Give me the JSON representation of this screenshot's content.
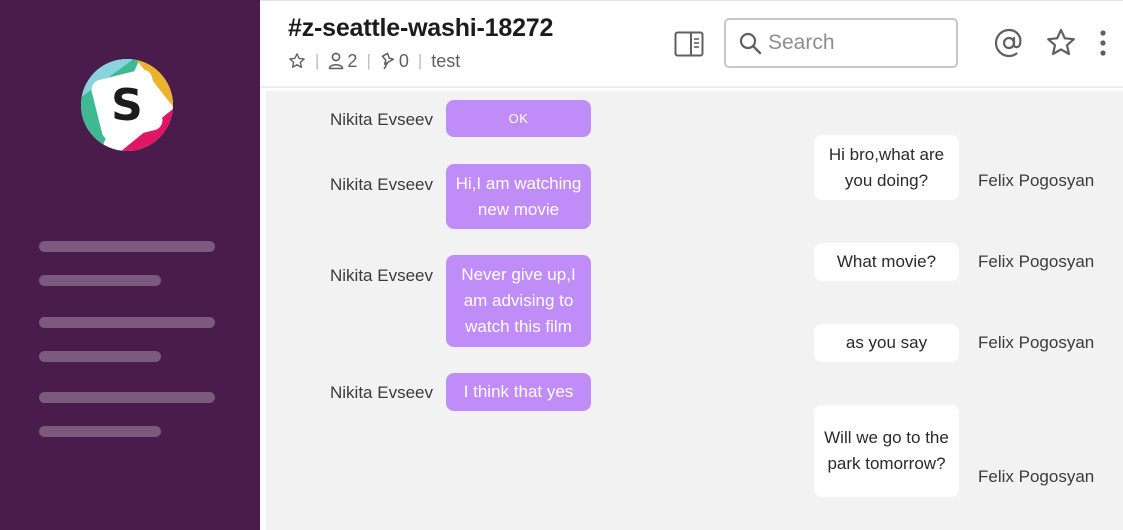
{
  "header": {
    "channel_name": "#z-seattle-washi-18272",
    "members_count": "2",
    "pinned_count": "0",
    "topic": "test"
  },
  "search": {
    "placeholder": "Search"
  },
  "messages": {
    "left": [
      {
        "author": "Nikita Evseev",
        "text": "OK"
      },
      {
        "author": "Nikita Evseev",
        "text": "Hi,I am watching new movie"
      },
      {
        "author": "Nikita Evseev",
        "text": "Never give up,I am advising to watch this film"
      },
      {
        "author": "Nikita Evseev",
        "text": "I think that yes"
      }
    ],
    "right": [
      {
        "author": "Felix Pogosyan",
        "text": "Hi bro,what are you doing?"
      },
      {
        "author": "Felix Pogosyan",
        "text": "What movie?"
      },
      {
        "author": "Felix Pogosyan",
        "text": "as you say"
      },
      {
        "author": "Felix Pogosyan",
        "text": "Will we go to the park tomorrow?"
      }
    ]
  },
  "colors": {
    "sidebar": "#4a1c4c",
    "sent_bubble": "#c08cf7",
    "received_bubble": "#ffffff",
    "chat_background": "#f2f2f2"
  },
  "icons": {
    "logo": "slack-logo-icon",
    "star": "star-icon",
    "members": "member-icon",
    "pins": "pin-icon",
    "details": "details-panel-icon",
    "search": "search-icon",
    "mentions": "at-sign-icon",
    "more": "more-vertical-icon"
  }
}
